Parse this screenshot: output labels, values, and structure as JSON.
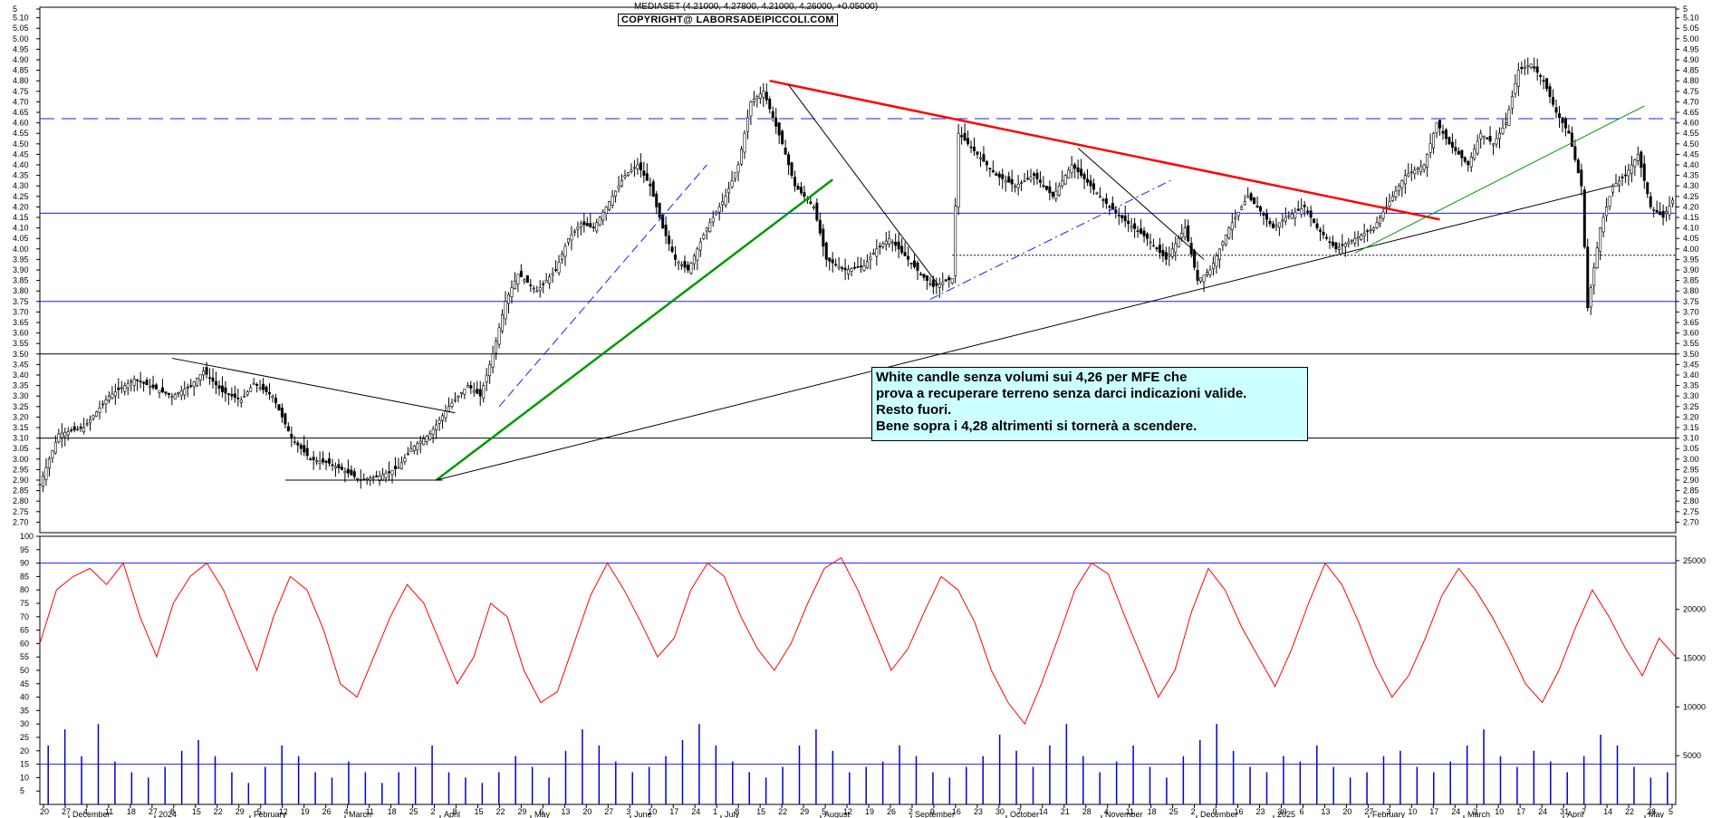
{
  "header": {
    "title": "MEDIASET (4.21000, 4.27800, 4.21000, 4.26000, +0.05000)",
    "copyright": "COPYRIGHT@ LABORSADEIPICCOLI.COM"
  },
  "annotation": {
    "lines": [
      "White candle senza volumi sui 4,26 per MFE che",
      "prova a recuperare terreno senza darci indicazioni valide.",
      "Resto fuori.",
      "Bene sopra i 4,28 altrimenti si tornerà a scendere."
    ]
  },
  "chart_data": [
    {
      "type": "candlestick",
      "title": "MEDIASET (4.21000, 4.27800, 4.21000, 4.26000, +0.05000)",
      "ylim": [
        2.65,
        5.15
      ],
      "y_ticks": [
        "2.70",
        "2.75",
        "2.80",
        "2.85",
        "2.90",
        "2.95",
        "3.00",
        "3.05",
        "3.10",
        "3.15",
        "3.20",
        "3.25",
        "3.30",
        "3.35",
        "3.40",
        "3.45",
        "3.50",
        "3.55",
        "3.60",
        "3.65",
        "3.70",
        "3.75",
        "3.80",
        "3.85",
        "3.90",
        "3.95",
        "4.00",
        "4.05",
        "4.10",
        "4.15",
        "4.20",
        "4.25",
        "4.30",
        "4.35",
        "4.40",
        "4.45",
        "4.50",
        "4.55",
        "4.60",
        "4.65",
        "4.70",
        "4.75",
        "4.80",
        "4.85",
        "4.90",
        "4.95",
        "5.00",
        "5.05",
        "5.10",
        "5"
      ],
      "last_bar": {
        "open": 4.21,
        "high": 4.278,
        "low": 4.21,
        "close": 4.26,
        "change": 0.05
      },
      "price_path": [
        [
          0,
          2.88
        ],
        [
          6,
          3.12
        ],
        [
          14,
          3.15
        ],
        [
          22,
          3.3
        ],
        [
          30,
          3.38
        ],
        [
          36,
          3.34
        ],
        [
          42,
          3.3
        ],
        [
          48,
          3.35
        ],
        [
          52,
          3.42
        ],
        [
          58,
          3.32
        ],
        [
          64,
          3.28
        ],
        [
          68,
          3.36
        ],
        [
          74,
          3.3
        ],
        [
          80,
          3.1
        ],
        [
          86,
          3.0
        ],
        [
          92,
          2.98
        ],
        [
          96,
          2.95
        ],
        [
          102,
          2.9
        ],
        [
          108,
          2.92
        ],
        [
          114,
          2.96
        ],
        [
          118,
          3.05
        ],
        [
          124,
          3.12
        ],
        [
          130,
          3.25
        ],
        [
          136,
          3.35
        ],
        [
          140,
          3.3
        ],
        [
          144,
          3.5
        ],
        [
          148,
          3.75
        ],
        [
          152,
          3.88
        ],
        [
          158,
          3.8
        ],
        [
          164,
          3.9
        ],
        [
          168,
          4.05
        ],
        [
          172,
          4.12
        ],
        [
          176,
          4.1
        ],
        [
          180,
          4.2
        ],
        [
          186,
          4.35
        ],
        [
          190,
          4.4
        ],
        [
          194,
          4.3
        ],
        [
          198,
          4.1
        ],
        [
          202,
          3.95
        ],
        [
          206,
          3.9
        ],
        [
          212,
          4.1
        ],
        [
          218,
          4.25
        ],
        [
          222,
          4.4
        ],
        [
          226,
          4.7
        ],
        [
          230,
          4.75
        ],
        [
          236,
          4.5
        ],
        [
          240,
          4.3
        ],
        [
          246,
          4.2
        ],
        [
          250,
          3.95
        ],
        [
          256,
          3.9
        ],
        [
          262,
          3.92
        ],
        [
          266,
          4.0
        ],
        [
          270,
          4.05
        ],
        [
          276,
          3.95
        ],
        [
          280,
          3.88
        ],
        [
          284,
          3.82
        ],
        [
          290,
          3.86
        ],
        [
          292,
          4.55
        ],
        [
          298,
          4.45
        ],
        [
          304,
          4.35
        ],
        [
          310,
          4.3
        ],
        [
          316,
          4.35
        ],
        [
          322,
          4.25
        ],
        [
          328,
          4.4
        ],
        [
          334,
          4.3
        ],
        [
          340,
          4.2
        ],
        [
          346,
          4.12
        ],
        [
          352,
          4.05
        ],
        [
          358,
          3.95
        ],
        [
          364,
          4.1
        ],
        [
          368,
          3.85
        ],
        [
          372,
          3.9
        ],
        [
          378,
          4.1
        ],
        [
          384,
          4.25
        ],
        [
          388,
          4.18
        ],
        [
          392,
          4.1
        ],
        [
          396,
          4.15
        ],
        [
          402,
          4.2
        ],
        [
          406,
          4.1
        ],
        [
          412,
          4.0
        ],
        [
          418,
          4.05
        ],
        [
          424,
          4.1
        ],
        [
          428,
          4.2
        ],
        [
          434,
          4.35
        ],
        [
          440,
          4.4
        ],
        [
          444,
          4.6
        ],
        [
          448,
          4.5
        ],
        [
          454,
          4.4
        ],
        [
          458,
          4.55
        ],
        [
          462,
          4.5
        ],
        [
          466,
          4.6
        ],
        [
          470,
          4.85
        ],
        [
          474,
          4.88
        ],
        [
          478,
          4.8
        ],
        [
          482,
          4.65
        ],
        [
          486,
          4.55
        ],
        [
          490,
          4.3
        ],
        [
          492,
          3.72
        ],
        [
          496,
          4.1
        ],
        [
          500,
          4.3
        ],
        [
          504,
          4.35
        ],
        [
          508,
          4.45
        ],
        [
          512,
          4.2
        ],
        [
          516,
          4.15
        ],
        [
          520,
          4.26
        ]
      ],
      "horizontal_levels": [
        3.1,
        3.5,
        3.75,
        4.17,
        4.62
      ],
      "trendlines": [
        {
          "color": "red",
          "from": [
            232,
            4.8
          ],
          "to": [
            445,
            4.14
          ]
        },
        {
          "color": "green",
          "from": [
            126,
            2.9
          ],
          "to": [
            252,
            4.33
          ]
        },
        {
          "color": "black",
          "from": [
            126,
            2.9
          ],
          "to": [
            500,
            4.3
          ]
        }
      ]
    },
    {
      "type": "bar+line",
      "series": [
        {
          "kind": "bar",
          "values": [
            22,
            28,
            18,
            30,
            16,
            12,
            10,
            14,
            20,
            24,
            18,
            12,
            8,
            14,
            22,
            18,
            12,
            10,
            16,
            12,
            8,
            12,
            14,
            22,
            12,
            10,
            8,
            12,
            18,
            14,
            10,
            20,
            28,
            22,
            16,
            12,
            14,
            18,
            24,
            30,
            22,
            16,
            12,
            10,
            14,
            22,
            28,
            20,
            12,
            14,
            16,
            22,
            18,
            12,
            10,
            14,
            18,
            26,
            20,
            14,
            22,
            30,
            18,
            12,
            16,
            22,
            14,
            10,
            18,
            24,
            30,
            20,
            14,
            12,
            18,
            16,
            22,
            14,
            10,
            12,
            18,
            20,
            14,
            12,
            16,
            22,
            28,
            18,
            14,
            20,
            16,
            12,
            18,
            26,
            22,
            14,
            10,
            12
          ]
        },
        {
          "kind": "line",
          "values": [
            60,
            80,
            85,
            88,
            82,
            90,
            70,
            55,
            75,
            85,
            90,
            80,
            65,
            50,
            70,
            85,
            80,
            65,
            45,
            40,
            55,
            70,
            82,
            75,
            60,
            45,
            55,
            75,
            70,
            50,
            38,
            42,
            60,
            78,
            90,
            80,
            68,
            55,
            62,
            80,
            90,
            85,
            70,
            58,
            50,
            60,
            75,
            88,
            92,
            80,
            65,
            50,
            58,
            72,
            85,
            80,
            68,
            50,
            38,
            30,
            45,
            62,
            80,
            90,
            86,
            70,
            55,
            40,
            50,
            72,
            88,
            80,
            66,
            55,
            44,
            58,
            75,
            90,
            82,
            68,
            52,
            40,
            48,
            62,
            78,
            88,
            80,
            70,
            58,
            45,
            38,
            50,
            66,
            80,
            70,
            58,
            48,
            62,
            55
          ]
        }
      ],
      "y_ticks_left": [
        "5",
        "10",
        "15",
        "20",
        "25",
        "30",
        "35",
        "40",
        "45",
        "50",
        "55",
        "60",
        "65",
        "70",
        "75",
        "80",
        "85",
        "90",
        "95",
        "100"
      ],
      "y_ticks_right": [
        "5000",
        "10000",
        "15000",
        "20000",
        "25000"
      ],
      "levels": [
        15,
        90
      ]
    }
  ],
  "x_axis": {
    "day_ticks": [
      "20",
      "27",
      "4",
      "11",
      "18",
      "27",
      "8",
      "15",
      "22",
      "29",
      "5",
      "12",
      "19",
      "26",
      "4",
      "11",
      "18",
      "25",
      "2",
      "8",
      "15",
      "22",
      "29",
      "6",
      "13",
      "20",
      "27",
      "3",
      "10",
      "17",
      "24",
      "1",
      "8",
      "15",
      "22",
      "29",
      "5",
      "12",
      "19",
      "26",
      "2",
      "9",
      "16",
      "23",
      "30",
      "7",
      "14",
      "21",
      "28",
      "4",
      "11",
      "18",
      "25",
      "2",
      "9",
      "16",
      "23",
      "30",
      "6",
      "13",
      "20",
      "27",
      "3",
      "10",
      "17",
      "24",
      "3",
      "10",
      "17",
      "24",
      "31",
      "7",
      "14",
      "22",
      "28",
      "5"
    ],
    "months": [
      "December",
      "2024",
      "February",
      "March",
      "April",
      "May",
      "June",
      "July",
      "August",
      "September",
      "October",
      "November",
      "December",
      "2025",
      "February",
      "March",
      "April",
      "May"
    ]
  },
  "colors": {
    "candle": "#000000",
    "volume": "#0000cc",
    "oscillator": "#ff0000",
    "level_line": "#1a1aff",
    "trend_red": "#ff0000",
    "trend_green": "#009900",
    "note_bg": "#ccffff"
  }
}
